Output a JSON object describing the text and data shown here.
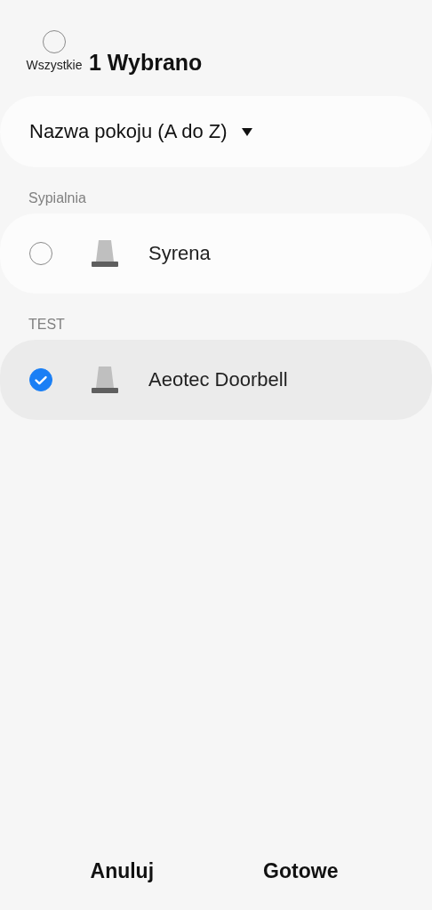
{
  "header": {
    "select_all": {
      "label": "Wszystkie",
      "checked": false
    },
    "title": "1 Wybrano"
  },
  "sort": {
    "label": "Nazwa pokoju (A do Z)"
  },
  "groups": [
    {
      "room": "Sypialnia",
      "devices": [
        {
          "name": "Syrena",
          "selected": false
        }
      ]
    },
    {
      "room": "TEST",
      "devices": [
        {
          "name": "Aeotec Doorbell",
          "selected": true
        }
      ]
    }
  ],
  "buttons": [
    "Anuluj",
    "Gotowe"
  ]
}
